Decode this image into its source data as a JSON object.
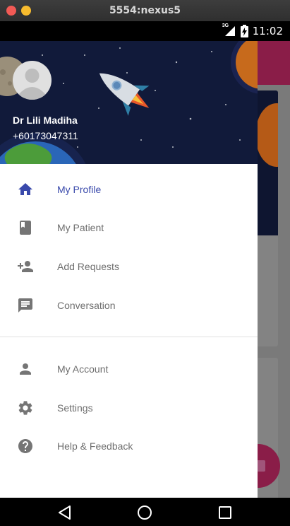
{
  "window": {
    "title": "5554:nexus5"
  },
  "status_bar": {
    "network": "3G",
    "time": "11:02"
  },
  "drawer": {
    "user": {
      "name": "Dr Lili Madiha",
      "phone": "+60173047311"
    },
    "primary_items": [
      {
        "label": "My Profile",
        "icon": "home-icon",
        "active": true
      },
      {
        "label": "My Patient",
        "icon": "book-icon",
        "active": false
      },
      {
        "label": "Add Requests",
        "icon": "person-add-icon",
        "active": false
      },
      {
        "label": "Conversation",
        "icon": "message-icon",
        "active": false
      }
    ],
    "secondary_items": [
      {
        "label": "My Account",
        "icon": "person-icon"
      },
      {
        "label": "Settings",
        "icon": "gear-icon"
      },
      {
        "label": "Help & Feedback",
        "icon": "help-icon"
      }
    ]
  },
  "colors": {
    "accent": "#3949ab",
    "header_bg": "#111a3a",
    "app_primary": "#8a1d48"
  }
}
